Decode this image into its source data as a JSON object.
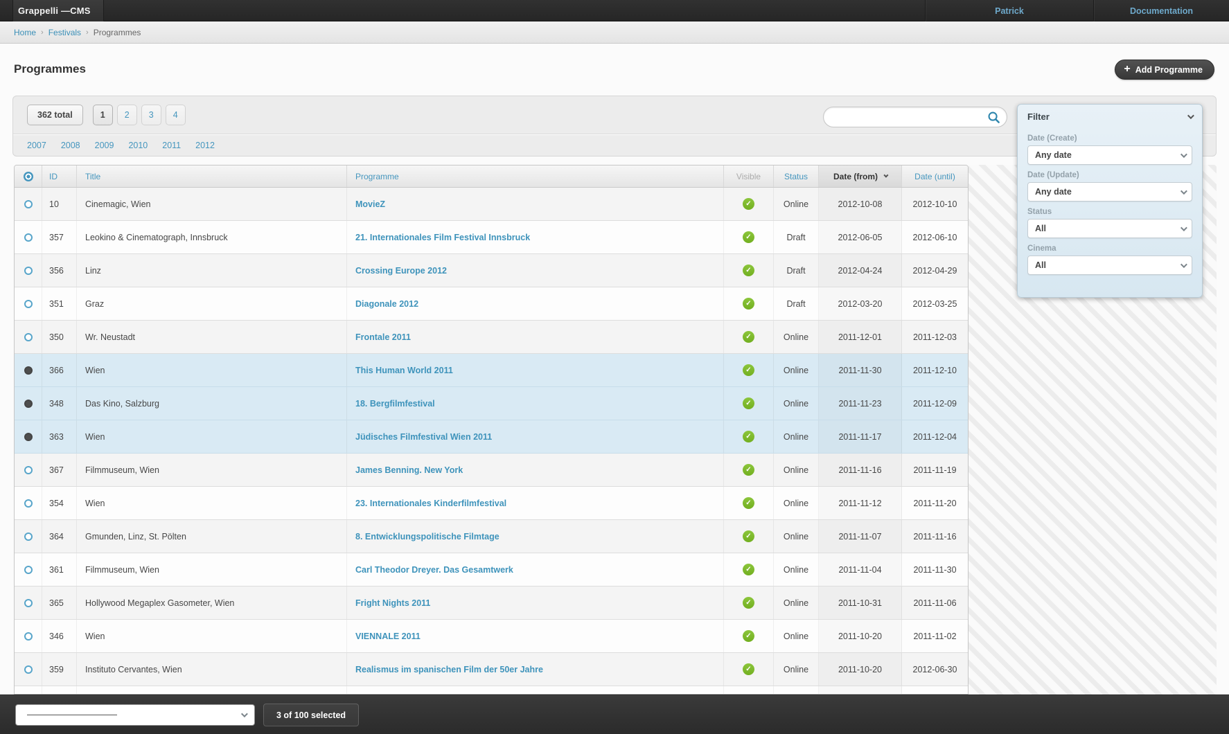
{
  "topbar": {
    "logo": "Grappelli —CMS",
    "user": "Patrick",
    "docs": "Documentation"
  },
  "breadcrumb": {
    "items": [
      "Home",
      "Festivals"
    ],
    "separator": "›",
    "current": "Programmes"
  },
  "page": {
    "title": "Programmes",
    "add_button": "Add Programme",
    "add_icon": "+"
  },
  "toolbar": {
    "total_label": "362 total",
    "pages": [
      "1",
      "2",
      "3",
      "4"
    ],
    "current_page": "1",
    "years": [
      "2007",
      "2008",
      "2009",
      "2010",
      "2011",
      "2012"
    ],
    "search_value": ""
  },
  "filter_panel": {
    "title": "Filter",
    "groups": [
      {
        "label": "Date (Create)",
        "value": "Any date"
      },
      {
        "label": "Date (Update)",
        "value": "Any date"
      },
      {
        "label": "Status",
        "value": "All"
      },
      {
        "label": "Cinema",
        "value": "All"
      }
    ]
  },
  "table": {
    "headers": {
      "id": "ID",
      "title": "Title",
      "programme": "Programme",
      "visible": "Visible",
      "status": "Status",
      "date_from": "Date (from)",
      "date_until": "Date (until)"
    },
    "sorted_by": "date_from",
    "visible_check": "✓",
    "rows": [
      {
        "id": "10",
        "title": "Cinemagic, Wien",
        "programme": "MovieZ",
        "visible": true,
        "status": "Online",
        "date_from": "2012-10-08",
        "date_until": "2012-10-10",
        "selected": false
      },
      {
        "id": "357",
        "title": "Leokino & Cinematograph, Innsbruck",
        "programme": "21. Internationales Film Festival Innsbruck",
        "visible": true,
        "status": "Draft",
        "date_from": "2012-06-05",
        "date_until": "2012-06-10",
        "selected": false
      },
      {
        "id": "356",
        "title": "Linz",
        "programme": "Crossing Europe 2012",
        "visible": true,
        "status": "Draft",
        "date_from": "2012-04-24",
        "date_until": "2012-04-29",
        "selected": false
      },
      {
        "id": "351",
        "title": "Graz",
        "programme": "Diagonale 2012",
        "visible": true,
        "status": "Draft",
        "date_from": "2012-03-20",
        "date_until": "2012-03-25",
        "selected": false
      },
      {
        "id": "350",
        "title": "Wr. Neustadt",
        "programme": "Frontale 2011",
        "visible": true,
        "status": "Online",
        "date_from": "2011-12-01",
        "date_until": "2011-12-03",
        "selected": false
      },
      {
        "id": "366",
        "title": "Wien",
        "programme": "This Human World 2011",
        "visible": true,
        "status": "Online",
        "date_from": "2011-11-30",
        "date_until": "2011-12-10",
        "selected": true
      },
      {
        "id": "348",
        "title": "Das Kino, Salzburg",
        "programme": "18. Bergfilmfestival",
        "visible": true,
        "status": "Online",
        "date_from": "2011-11-23",
        "date_until": "2011-12-09",
        "selected": true
      },
      {
        "id": "363",
        "title": "Wien",
        "programme": "Jüdisches Filmfestival Wien 2011",
        "visible": true,
        "status": "Online",
        "date_from": "2011-11-17",
        "date_until": "2011-12-04",
        "selected": true
      },
      {
        "id": "367",
        "title": "Filmmuseum, Wien",
        "programme": "James Benning. New York",
        "visible": true,
        "status": "Online",
        "date_from": "2011-11-16",
        "date_until": "2011-11-19",
        "selected": false
      },
      {
        "id": "354",
        "title": "Wien",
        "programme": "23. Internationales Kinderfilmfestival",
        "visible": true,
        "status": "Online",
        "date_from": "2011-11-12",
        "date_until": "2011-11-20",
        "selected": false
      },
      {
        "id": "364",
        "title": "Gmunden, Linz, St. Pölten",
        "programme": "8. Entwicklungspolitische Filmtage",
        "visible": true,
        "status": "Online",
        "date_from": "2011-11-07",
        "date_until": "2011-11-16",
        "selected": false
      },
      {
        "id": "361",
        "title": "Filmmuseum, Wien",
        "programme": "Carl Theodor Dreyer. Das Gesamtwerk",
        "visible": true,
        "status": "Online",
        "date_from": "2011-11-04",
        "date_until": "2011-11-30",
        "selected": false
      },
      {
        "id": "365",
        "title": "Hollywood Megaplex Gasometer, Wien",
        "programme": "Fright Nights 2011",
        "visible": true,
        "status": "Online",
        "date_from": "2011-10-31",
        "date_until": "2011-11-06",
        "selected": false
      },
      {
        "id": "346",
        "title": "Wien",
        "programme": "VIENNALE 2011",
        "visible": true,
        "status": "Online",
        "date_from": "2011-10-20",
        "date_until": "2011-11-02",
        "selected": false
      },
      {
        "id": "359",
        "title": "Instituto Cervantes, Wien",
        "programme": "Realismus im spanischen Film der 50er Jahre",
        "visible": true,
        "status": "Online",
        "date_from": "2011-10-20",
        "date_until": "2012-06-30",
        "selected": false
      }
    ]
  },
  "footer": {
    "selected_text": "3 of 100 selected"
  },
  "colors": {
    "accent_blue": "#4596be",
    "link_blue": "#3e93bb",
    "visible_green": "#7cb82f",
    "selected_row": "#d9eaf4",
    "topbar_dark": "#2b2b2b",
    "filter_bg": "#dce9f1"
  }
}
